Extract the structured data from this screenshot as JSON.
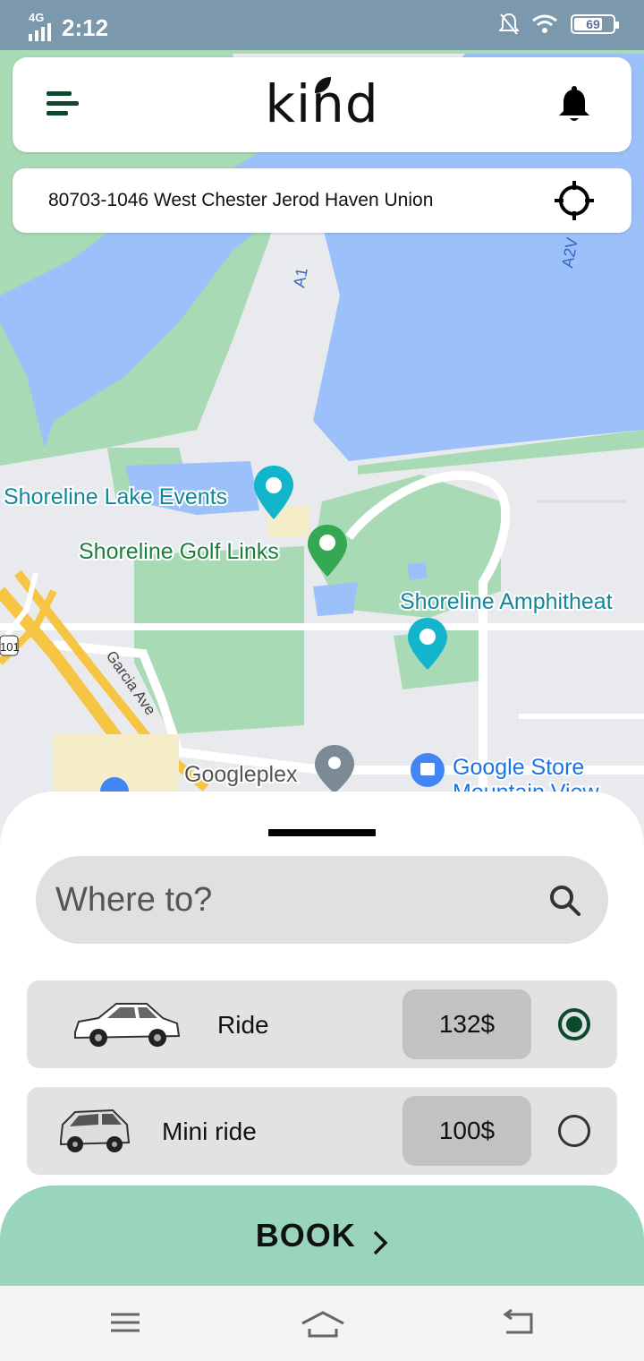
{
  "status_bar": {
    "network": "4G",
    "time": "2:12",
    "battery": "69"
  },
  "header": {
    "logo_text": "kind"
  },
  "address": {
    "text": "80703-1046 West Chester Jerod Haven Union"
  },
  "map": {
    "labels": {
      "lake_events": "Shoreline Lake Events",
      "golf_links": "Shoreline Golf Links",
      "amphitheatre": "Shoreline Amphitheat",
      "garcia_ave": "Garcia Ave",
      "googleplex": "Googleplex",
      "google_store": "Google Store",
      "google_store_2": "Mountain View",
      "road_a1": "A1",
      "road_a2": "A2V",
      "route_101": "101"
    },
    "colors": {
      "water": "#9cc0f9",
      "park": "#a8dab5",
      "land": "#e8eaed"
    }
  },
  "sheet": {
    "search_placeholder": "Where to?",
    "options": [
      {
        "label": "Ride",
        "price": "132$",
        "selected": true
      },
      {
        "label": "Mini ride",
        "price": "100$",
        "selected": false
      }
    ],
    "book_label": "BOOK"
  },
  "colors": {
    "brand_green": "#0b4a2c",
    "book_bg": "#98d5bc",
    "option_bg": "#e2e2e2",
    "price_bg": "#c2c2c2"
  }
}
